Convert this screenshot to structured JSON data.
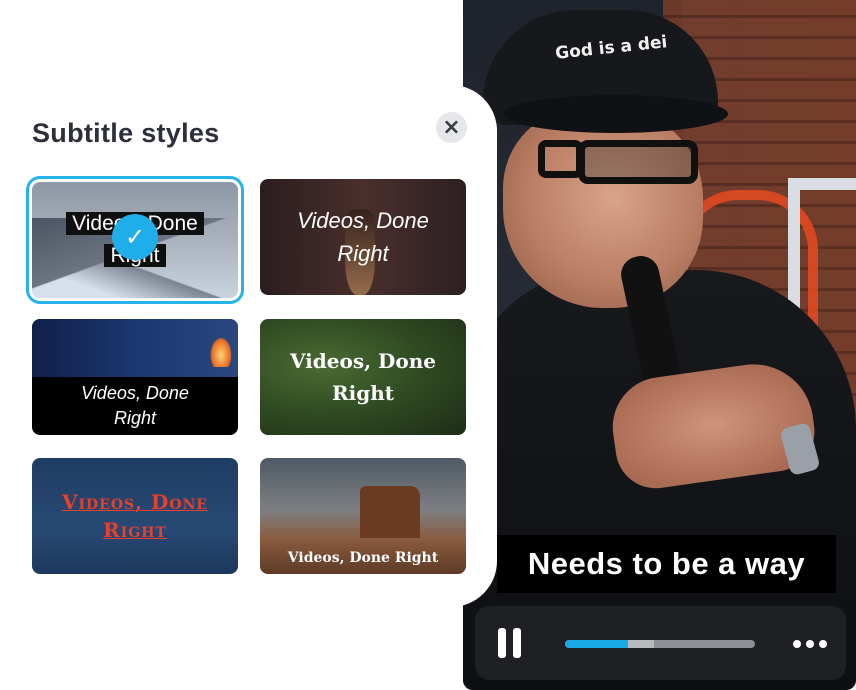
{
  "panel": {
    "title": "Subtitle styles",
    "close_label": "×",
    "styles": [
      {
        "label_line1": "Videos, Done",
        "label_line2": "Right",
        "selected": true
      },
      {
        "label_line1": "Videos, Done",
        "label_line2": "Right",
        "selected": false
      },
      {
        "label_line1": "Videos, Done",
        "label_line2": "Right",
        "selected": false
      },
      {
        "label_line1": "Videos, Done",
        "label_line2": "Right",
        "selected": false
      },
      {
        "label_line1": "Videos, Done",
        "label_line2": "Right",
        "selected": false
      },
      {
        "label": "Videos, Done Right",
        "selected": false
      }
    ],
    "check_symbol": "✓"
  },
  "video": {
    "caption": "Needs to be a way",
    "cap_text": "God is a dei",
    "player": {
      "progress": 0.33,
      "buffered": 0.47
    }
  },
  "colors": {
    "accent": "#27b2ea",
    "progress_fill": "#1ba8e6",
    "caption_bg": "#000000",
    "player_bg": "#1e2024"
  }
}
